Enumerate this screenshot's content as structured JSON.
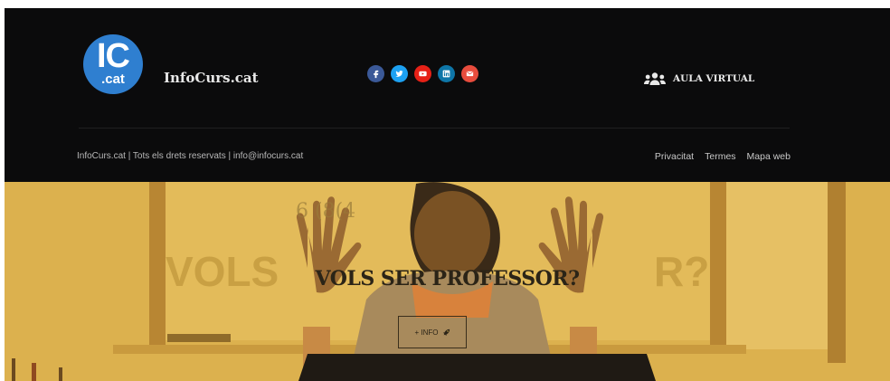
{
  "footer": {
    "logo": {
      "top": "IC",
      "bottom": ".cat"
    },
    "brand": "InfoCurs.cat",
    "socials": [
      {
        "name": "facebook",
        "color": "#3b5998"
      },
      {
        "name": "twitter",
        "color": "#1da1f2"
      },
      {
        "name": "youtube",
        "color": "#e62117"
      },
      {
        "name": "linkedin",
        "color": "#0e76a8"
      },
      {
        "name": "email",
        "color": "#e84c3d"
      }
    ],
    "aula_virtual": "AULA VIRTUAL",
    "copyright": "InfoCurs.cat | Tots els drets reservats | info@infocurs.cat",
    "links": [
      "Privacitat",
      "Termes",
      "Mapa web"
    ]
  },
  "hero": {
    "board_text": "6 (8(4",
    "ghost_left": "VOLS",
    "ghost_right": "R?",
    "title": "VOLS SER PROFESSOR?",
    "button_label": "+ INFO"
  },
  "colors": {
    "footer_bg": "#0b0b0c",
    "logo_blue": "#2f7fd0",
    "hero_overlay": "#d9ae4a"
  }
}
